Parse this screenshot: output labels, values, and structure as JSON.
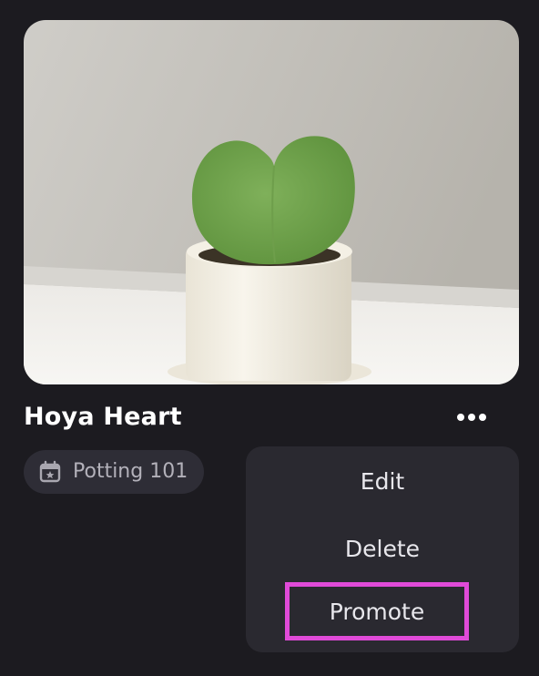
{
  "card": {
    "title": "Hoya Heart",
    "tag_label": "Potting 101",
    "tag_icon": "calendar-star-icon",
    "more_icon": "more-horizontal-icon"
  },
  "menu": {
    "items": [
      {
        "label": "Edit"
      },
      {
        "label": "Delete"
      },
      {
        "label": "Promote",
        "highlighted": true
      }
    ]
  },
  "colors": {
    "background": "#1c1b20",
    "menu_background": "#2a2930",
    "tag_background": "#2e2d36",
    "highlight_border": "#e04ad8"
  }
}
